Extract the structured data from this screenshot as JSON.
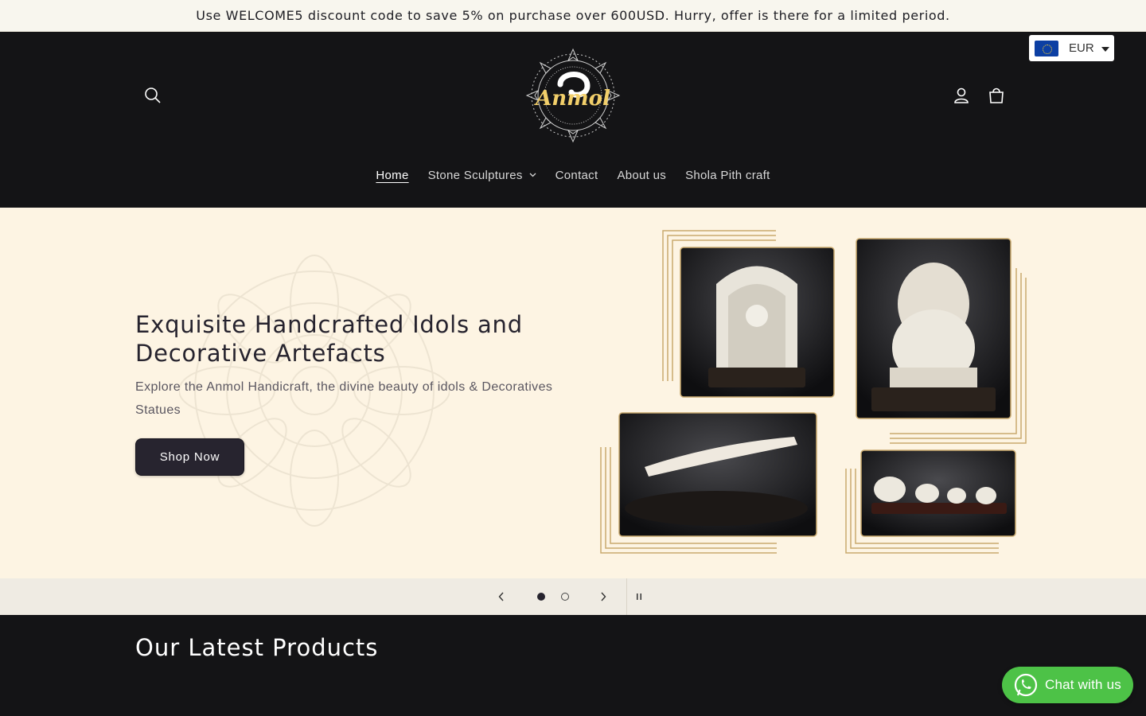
{
  "announcement": {
    "text": "Use WELCOME5 discount code to save 5% on purchase over 600USD. Hurry, offer is there for a limited period."
  },
  "currency": {
    "selected": "EUR",
    "flag_icon": "eu-flag-icon"
  },
  "header": {
    "logo_text": "Anmol",
    "icons": [
      "search-icon",
      "account-icon",
      "cart-icon"
    ]
  },
  "nav": {
    "items": [
      {
        "label": "Home",
        "active": true
      },
      {
        "label": "Stone Sculptures",
        "has_dropdown": true
      },
      {
        "label": "Contact"
      },
      {
        "label": "About us"
      },
      {
        "label": "Shola Pith craft"
      }
    ]
  },
  "hero": {
    "title": "Exquisite Handcrafted Idols and Decorative Artefacts",
    "subtitle": "Explore the Anmol Handicraft, the divine beauty of idols & Decoratives Statues",
    "cta_label": "Shop Now",
    "slide_count": 2,
    "active_slide": 1
  },
  "sections": {
    "latest_title": "Our Latest Products"
  },
  "chat": {
    "label": "Chat with us",
    "color": "#4dc247"
  },
  "colors": {
    "header_bg": "#141416",
    "hero_bg": "#fdf4e3",
    "accent_gold": "#c9a96e",
    "button_bg": "#27242f"
  }
}
